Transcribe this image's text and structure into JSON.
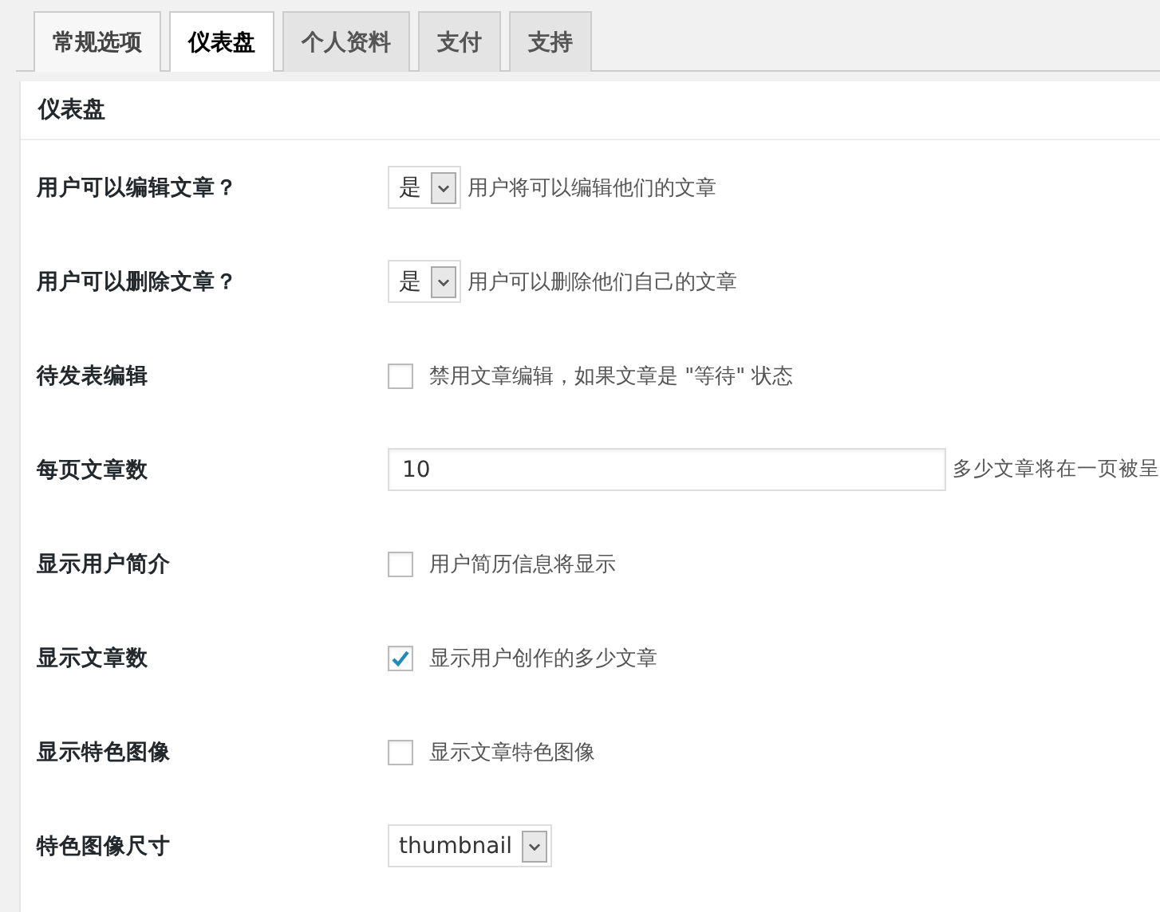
{
  "tabs": [
    {
      "label": "常规选项",
      "selected": false,
      "hovered": true
    },
    {
      "label": "仪表盘",
      "selected": true,
      "hovered": false
    },
    {
      "label": "个人资料",
      "selected": false,
      "hovered": false
    },
    {
      "label": "支付",
      "selected": false,
      "hovered": false
    },
    {
      "label": "支持",
      "selected": false,
      "hovered": false
    }
  ],
  "panel": {
    "title": "仪表盘"
  },
  "settings": [
    {
      "kind": "select",
      "label": "用户可以编辑文章？",
      "value": "是",
      "description": "用户将可以编辑他们的文章"
    },
    {
      "kind": "select",
      "label": "用户可以删除文章？",
      "value": "是",
      "description": "用户可以删除他们自己的文章"
    },
    {
      "kind": "checkbox",
      "label": "待发表编辑",
      "checked": false,
      "description": "禁用文章编辑，如果文章是 \"等待\" 状态"
    },
    {
      "kind": "text",
      "label": "每页文章数",
      "value": "10",
      "description": "多少文章将在一页被呈"
    },
    {
      "kind": "checkbox",
      "label": "显示用户简介",
      "checked": false,
      "description": "用户简历信息将显示"
    },
    {
      "kind": "checkbox",
      "label": "显示文章数",
      "checked": true,
      "description": "显示用户创作的多少文章"
    },
    {
      "kind": "checkbox",
      "label": "显示特色图像",
      "checked": false,
      "description": "显示文章特色图像"
    },
    {
      "kind": "select",
      "label": "特色图像尺寸",
      "value": "thumbnail"
    }
  ]
}
